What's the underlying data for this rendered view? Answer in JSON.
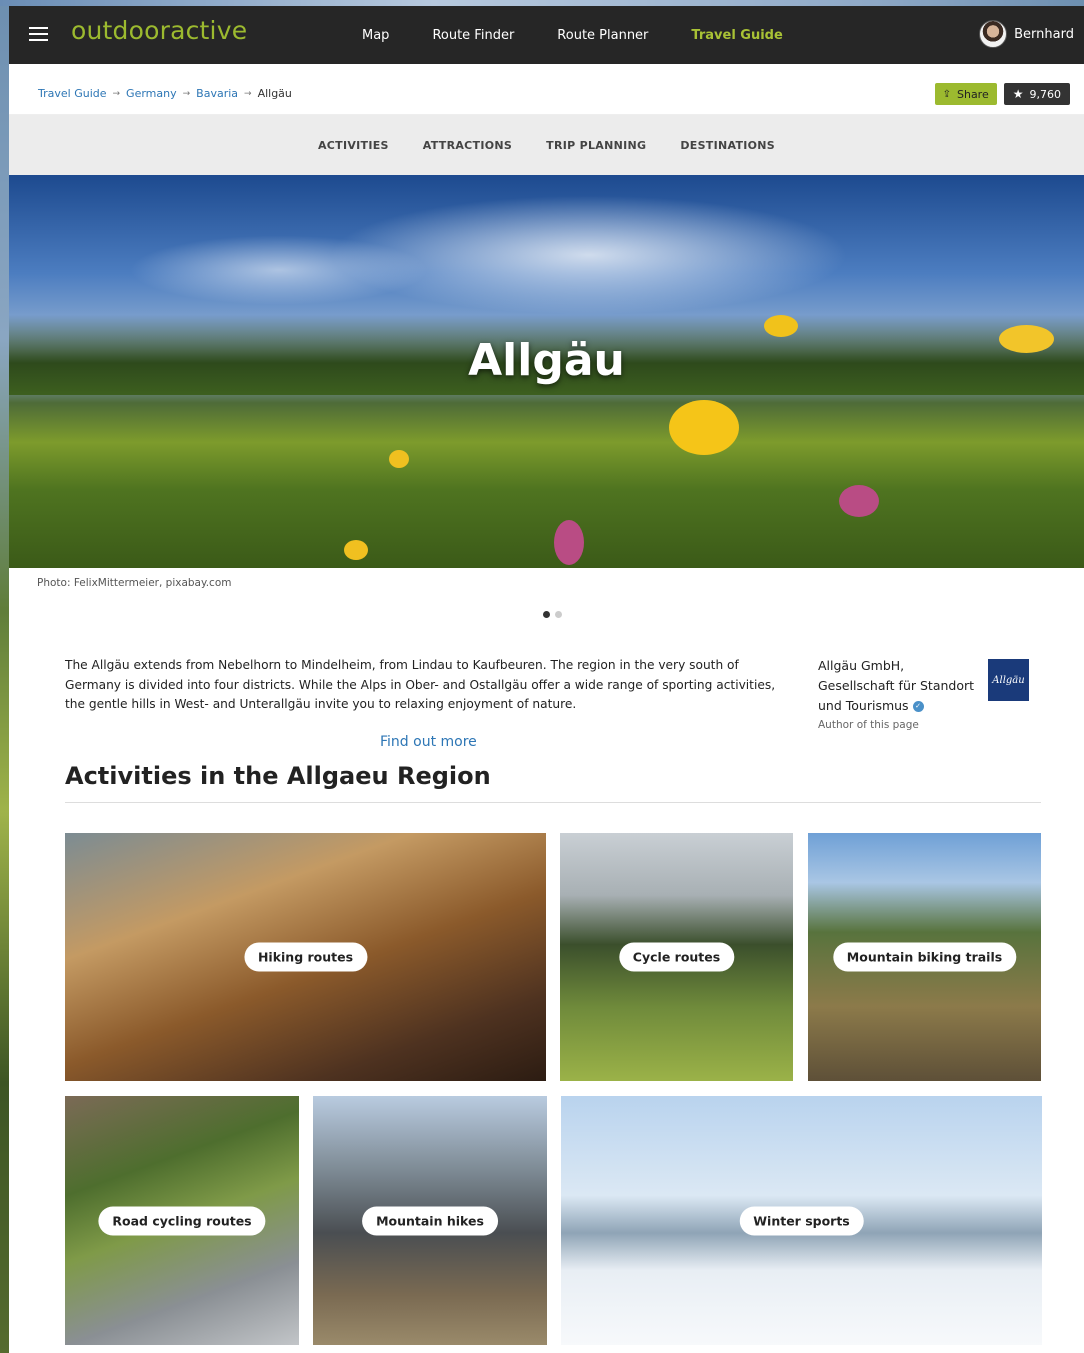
{
  "header": {
    "logo": "outdooractive",
    "nav": [
      "Map",
      "Route Finder",
      "Route Planner",
      "Travel Guide"
    ],
    "active_nav": "Travel Guide",
    "user_name": "Bernhard"
  },
  "breadcrumb": {
    "items": [
      "Travel Guide",
      "Germany",
      "Bavaria"
    ],
    "current": "Allgäu",
    "separator": "→"
  },
  "actions": {
    "share_label": "Share",
    "star_count": "9,760"
  },
  "tabs": [
    "ACTIVITIES",
    "ATTRACTIONS",
    "TRIP PLANNING",
    "DESTINATIONS"
  ],
  "hero": {
    "title": "Allgäu",
    "photo_credit": "Photo: FelixMittermeier, pixabay.com",
    "slide_count": 2,
    "active_slide": 1
  },
  "intro": {
    "text": "The Allgäu extends from Nebelhorn to Mindelheim, from Lindau to Kaufbeuren. The region in the very south of Germany is divided into four districts. While the Alps in Ober- and Ostallgäu offer a wide range of sporting activities, the gentle hills in West- and Unterallgäu invite you to relaxing enjoyment of nature.",
    "find_more": "Find out more"
  },
  "author": {
    "name_line1": "Allgäu GmbH,",
    "name_line2": "Gesellschaft für Standort",
    "name_line3": "und Tourismus",
    "role": "Author of this page",
    "logo_text": "Allgäu"
  },
  "activities": {
    "title": "Activities in the Allgaeu Region",
    "tiles": [
      "Hiking routes",
      "Cycle routes",
      "Mountain biking trails",
      "Road cycling routes",
      "Mountain hikes",
      "Winter sports"
    ]
  },
  "colors": {
    "brand_green": "#9cba2f",
    "header_bg": "#262626",
    "link_blue": "#2d76b5"
  },
  "icons": [
    "hamburger-icon",
    "share-icon",
    "star-icon",
    "verified-icon"
  ]
}
